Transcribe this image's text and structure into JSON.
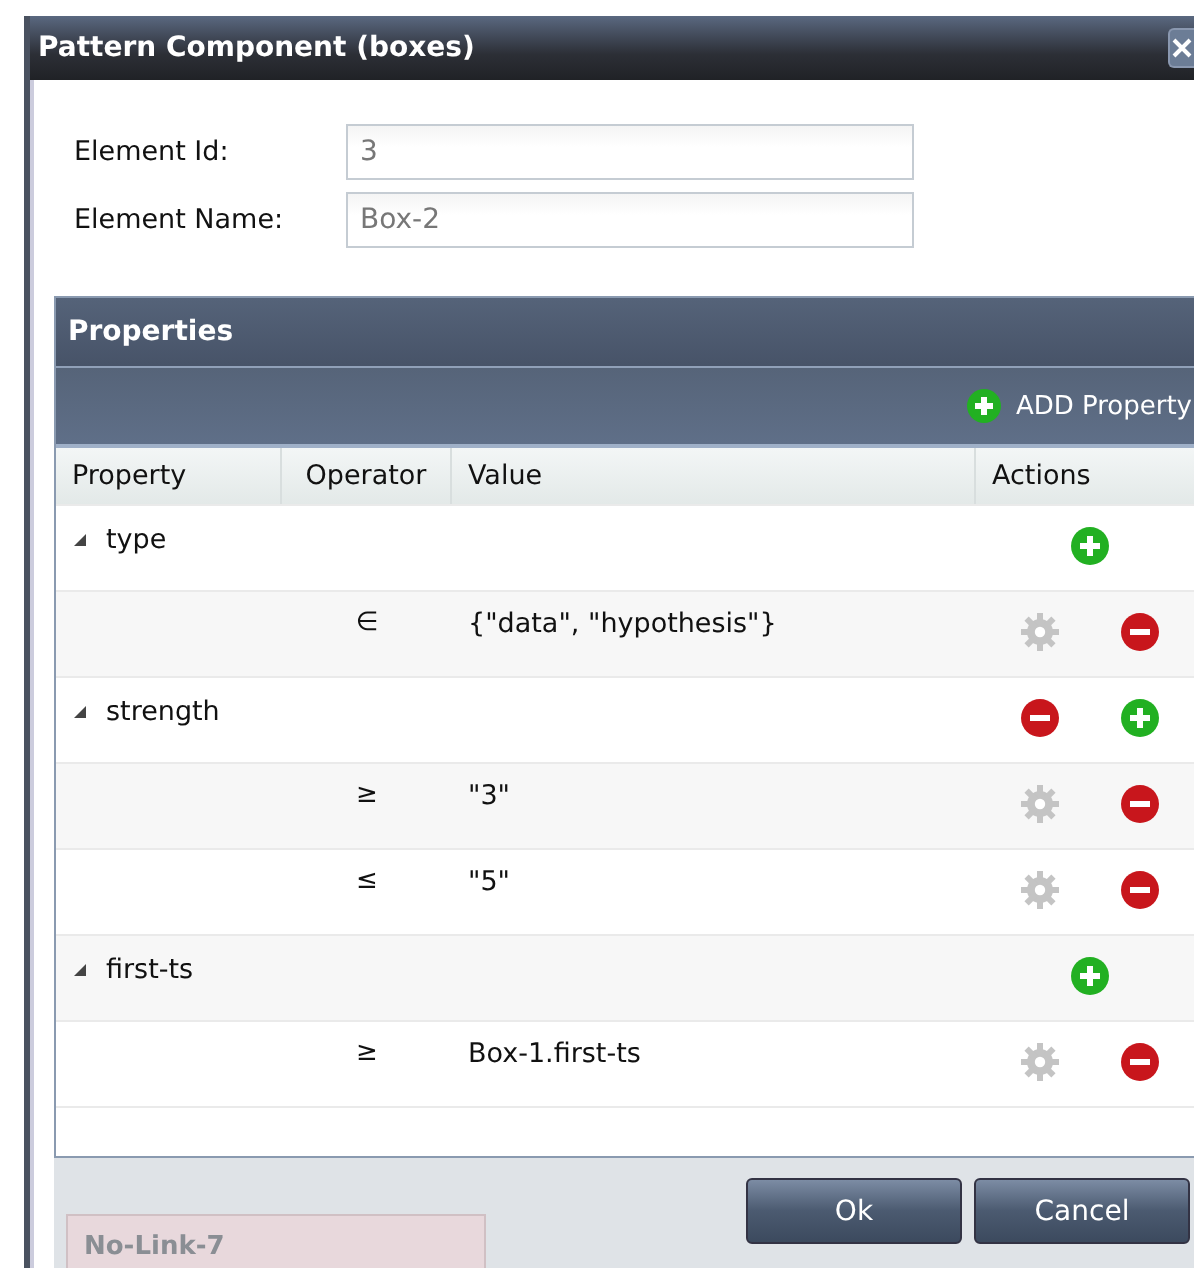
{
  "window": {
    "title": "Pattern Component (boxes)"
  },
  "fields": [
    {
      "label": "Element Id:",
      "value": "3"
    },
    {
      "label": "Element Name:",
      "value": "Box-2"
    }
  ],
  "properties": {
    "title": "Properties",
    "add_button": "ADD Property",
    "columns": [
      "Property",
      "Operator",
      "Value",
      "Actions"
    ],
    "rows": [
      {
        "kind": "group",
        "property": "type",
        "expanded": true,
        "actions": [
          {
            "kind": "add"
          }
        ]
      },
      {
        "kind": "condition",
        "operator": "∈",
        "value": "{\"data\", \"hypothesis\"}",
        "actions": [
          {
            "kind": "edit"
          },
          {
            "kind": "remove"
          }
        ]
      },
      {
        "kind": "group",
        "property": "strength",
        "expanded": true,
        "actions": [
          {
            "kind": "remove"
          },
          {
            "kind": "add"
          }
        ]
      },
      {
        "kind": "condition",
        "operator": "≥",
        "value": "\"3\"",
        "actions": [
          {
            "kind": "edit"
          },
          {
            "kind": "remove"
          }
        ]
      },
      {
        "kind": "condition",
        "operator": "≤",
        "value": "\"5\"",
        "actions": [
          {
            "kind": "edit"
          },
          {
            "kind": "remove"
          }
        ]
      },
      {
        "kind": "group",
        "property": "first-ts",
        "expanded": true,
        "actions": [
          {
            "kind": "add"
          }
        ]
      },
      {
        "kind": "condition",
        "operator": "≥",
        "value": "Box-1.first-ts",
        "actions": [
          {
            "kind": "edit"
          },
          {
            "kind": "remove"
          }
        ]
      }
    ]
  },
  "background": {
    "node_label": "No-Link-7"
  },
  "buttons": [
    "Ok",
    "Cancel"
  ]
}
